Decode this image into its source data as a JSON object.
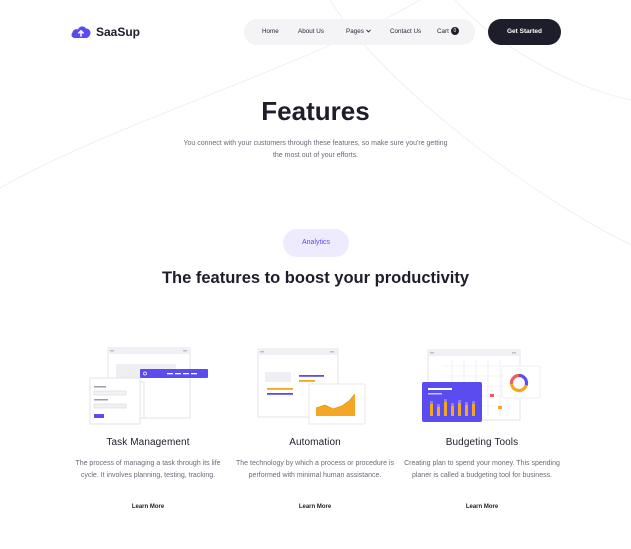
{
  "brand": {
    "name": "SaaSup",
    "accent": "#5b4cf0"
  },
  "nav": {
    "items": [
      {
        "label": "Home"
      },
      {
        "label": "About Us"
      },
      {
        "label": "Pages"
      },
      {
        "label": "Contact Us"
      },
      {
        "label": "Cart"
      }
    ],
    "cart_count": "0",
    "cta_label": "Get Started"
  },
  "hero": {
    "title": "Features",
    "subtitle": "You connect with your customers through these  features, so make sure you're getting the most out of your efforts."
  },
  "section": {
    "pill": "Analytics",
    "title": "The features to boost your productivity"
  },
  "features": [
    {
      "title": "Task Management",
      "description": "The process of managing a task through its life cycle. It involves planning, testing, tracking.",
      "link": "Learn More",
      "icon": "task-management-illustration"
    },
    {
      "title": "Automation",
      "description": "The technology by which a process or procedure is performed with minimal human assistance.",
      "link": "Learn More",
      "icon": "automation-illustration"
    },
    {
      "title": "Budgeting Tools",
      "description": "Creating plan to spend your money. This spending planer is called a budgeting tool for business.",
      "link": "Learn More",
      "icon": "budgeting-illustration"
    }
  ],
  "colors": {
    "dark": "#1d1d2b",
    "accent": "#5b4cf0",
    "pill_bg": "#eeebff",
    "orange": "#f5a623"
  }
}
